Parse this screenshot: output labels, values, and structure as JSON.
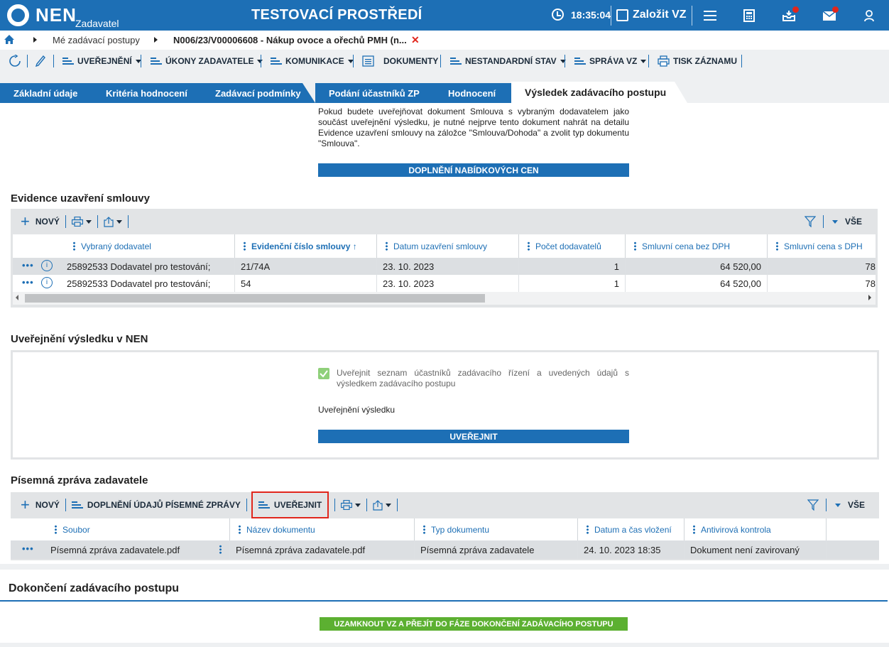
{
  "header": {
    "logo_text": "NEN",
    "logo_sub": "Zadavatel",
    "env_title": "TESTOVACÍ PROSTŘEDÍ",
    "time": "18:35:04",
    "create_label": "Založit VZ"
  },
  "breadcrumb": {
    "item1": "Mé zadávací postupy",
    "item2": "N006/23/V00006608 - Nákup ovoce a ořechů PMH (n...",
    "close": "✕"
  },
  "toolbar": {
    "uverejneni": "UVEŘEJNĚNÍ",
    "ukony": "ÚKONY ZADAVATELE",
    "komunikace": "KOMUNIKACE",
    "dokumenty": "DOKUMENTY",
    "nestandardni": "NESTANDARDNÍ STAV",
    "sprava": "SPRÁVA VZ",
    "tisk": "TISK ZÁZNAMU"
  },
  "tabs": [
    "Základní údaje",
    "Kritéria hodnocení",
    "Zadávací podmínky",
    "Podání účastníků ZP",
    "Hodnocení",
    "Výsledek zadávacího postupu"
  ],
  "info_text": "Pokud budete uveřejňovat dokument Smlouva s vybraným dodavatelem jako součást uveřejnění výsledku, je nutné nejprve tento dokument nahrát na detailu Evidence uzavření smlouvy na záložce \"Smlouva/Dohoda\" a zvolit typ dokumentu \"Smlouva\".",
  "btn_doplneni_cen": "DOPLNĚNÍ NABÍDKOVÝCH CEN",
  "evidence": {
    "title": "Evidence uzavření smlouvy",
    "new_label": "NOVÝ",
    "all_label": "VŠE",
    "columns": [
      "Vybraný dodavatel",
      "Evidenční číslo smlouvy ↑",
      "Datum uzavření smlouvy",
      "Počet dodavatelů",
      "Smluvní cena bez DPH",
      "Smluvní cena s DPH"
    ],
    "rows": [
      {
        "supplier": "25892533 Dodavatel pro testování;",
        "number": "21/74A",
        "date": "23. 10. 2023",
        "count": "1",
        "price": "64 520,00",
        "price_vat": "78"
      },
      {
        "supplier": "25892533 Dodavatel pro testování;",
        "number": "54",
        "date": "23. 10. 2023",
        "count": "1",
        "price": "64 520,00",
        "price_vat": "78"
      }
    ]
  },
  "uverejneni": {
    "title": "Uveřejnění výsledku v NEN",
    "checkbox_label": "Uveřejnit seznam účastníků zadávacího řízení a uvedených údajů s výsledkem zadávacího postupu",
    "checkbox_checked": true,
    "sub_label": "Uveřejnění výsledku",
    "button": "UVEŘEJNIT"
  },
  "zprava": {
    "title": "Písemná zpráva zadavatele",
    "new_label": "NOVÝ",
    "doplneni_label": "DOPLNĚNÍ ÚDAJŮ PÍSEMNÉ ZPRÁVY",
    "publish_label": "UVEŘEJNIT",
    "all_label": "VŠE",
    "columns": [
      "Soubor",
      "Název dokumentu",
      "Typ dokumentu",
      "Datum a čas vložení",
      "Antivirová kontrola"
    ],
    "rows": [
      {
        "file": "Písemná zpráva zadavatele.pdf",
        "name": "Písemná zpráva zadavatele.pdf",
        "type": "Písemná zpráva zadavatele",
        "date": "24. 10. 2023 18:35",
        "antivirus": "Dokument není zavirovaný"
      }
    ]
  },
  "dokonceni": {
    "title": "Dokončení zadávacího postupu",
    "button": "UZAMKNOUT VZ A PŘEJÍT DO FÁZE DOKONČENÍ ZADÁVACÍHO POSTUPU"
  },
  "colors": {
    "primary": "#1d6fb5",
    "green": "#5cb031",
    "red": "#e1261c"
  }
}
